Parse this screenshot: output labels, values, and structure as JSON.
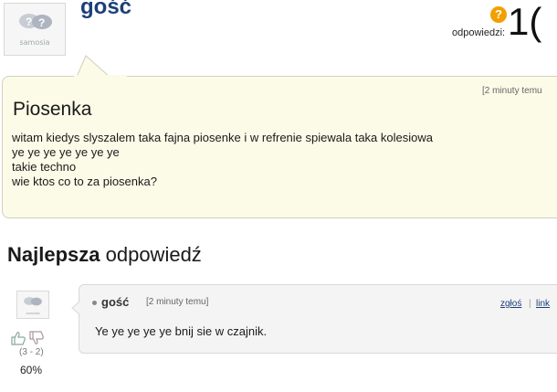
{
  "header": {
    "author": "gość",
    "avatar_caption": "samosia",
    "answers_icon": "?",
    "answers_label": "odpowiedzi:",
    "answers_count": "1("
  },
  "question": {
    "timestamp": "[2 minuty temu",
    "title": "Piosenka",
    "lines": [
      "witam kiedys slyszalem taka fajna piosenke i w refrenie spiewala taka kolesiowa",
      "ye ye ye ye ye ye ye",
      "takie techno",
      "wie ktos co to za piosenka?"
    ]
  },
  "best_answer": {
    "heading_bold": "Najlepsza",
    "heading_rest": " odpowiedź",
    "avatar_caption": "samosia",
    "votes": "(3 - 2)",
    "percent": "60%",
    "author": "gość",
    "timestamp": "[2 minuty temu]",
    "report_label": "zgłoś",
    "separator": "|",
    "link_label": "link",
    "text": "Ye ye ye ye ye bnij sie w czajnik."
  },
  "colors": {
    "author_blue": "#1c3f78",
    "bubble_bg": "#fbfbe8",
    "answer_bg": "#f4f4f4",
    "answers_icon": "#f2a000"
  }
}
